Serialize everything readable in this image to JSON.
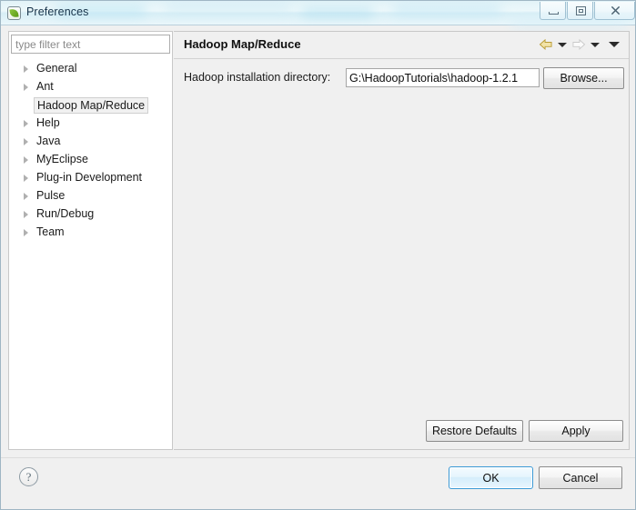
{
  "window": {
    "title": "Preferences",
    "icon": "myeclipse-leaf-icon",
    "controls": {
      "minimize": "Minimize",
      "maximize": "Maximize",
      "close": "Close"
    }
  },
  "sidebar": {
    "filter": {
      "value": "",
      "placeholder": "type filter text"
    },
    "items": [
      {
        "label": "General",
        "expandable": true,
        "selected": false
      },
      {
        "label": "Ant",
        "expandable": true,
        "selected": false
      },
      {
        "label": "Hadoop Map/Reduce",
        "expandable": false,
        "selected": true
      },
      {
        "label": "Help",
        "expandable": true,
        "selected": false
      },
      {
        "label": "Java",
        "expandable": true,
        "selected": false
      },
      {
        "label": "MyEclipse",
        "expandable": true,
        "selected": false
      },
      {
        "label": "Plug-in Development",
        "expandable": true,
        "selected": false
      },
      {
        "label": "Pulse",
        "expandable": true,
        "selected": false
      },
      {
        "label": "Run/Debug",
        "expandable": true,
        "selected": false
      },
      {
        "label": "Team",
        "expandable": true,
        "selected": false
      }
    ]
  },
  "content": {
    "title": "Hadoop Map/Reduce",
    "nav": {
      "back_icon": "back-arrow-icon",
      "back_caret_icon": "chevron-down-icon",
      "forward_icon": "forward-arrow-icon",
      "forward_caret_icon": "chevron-down-icon",
      "menu_caret_icon": "chevron-down-icon"
    },
    "field": {
      "label": "Hadoop installation directory:",
      "value": "G:\\HadoopTutorials\\hadoop-1.2.1",
      "placeholder": "",
      "browse_label": "Browse..."
    },
    "restore_defaults_label": "Restore Defaults",
    "apply_label": "Apply"
  },
  "footer": {
    "help_glyph": "?",
    "ok_label": "OK",
    "cancel_label": "Cancel"
  },
  "colors": {
    "accent": "#3c9ad6",
    "pane_background": "#f0f0f0",
    "tree_background": "#ffffff",
    "back_arrow": "#e8d080",
    "forward_arrow": "#e4e4e4"
  }
}
